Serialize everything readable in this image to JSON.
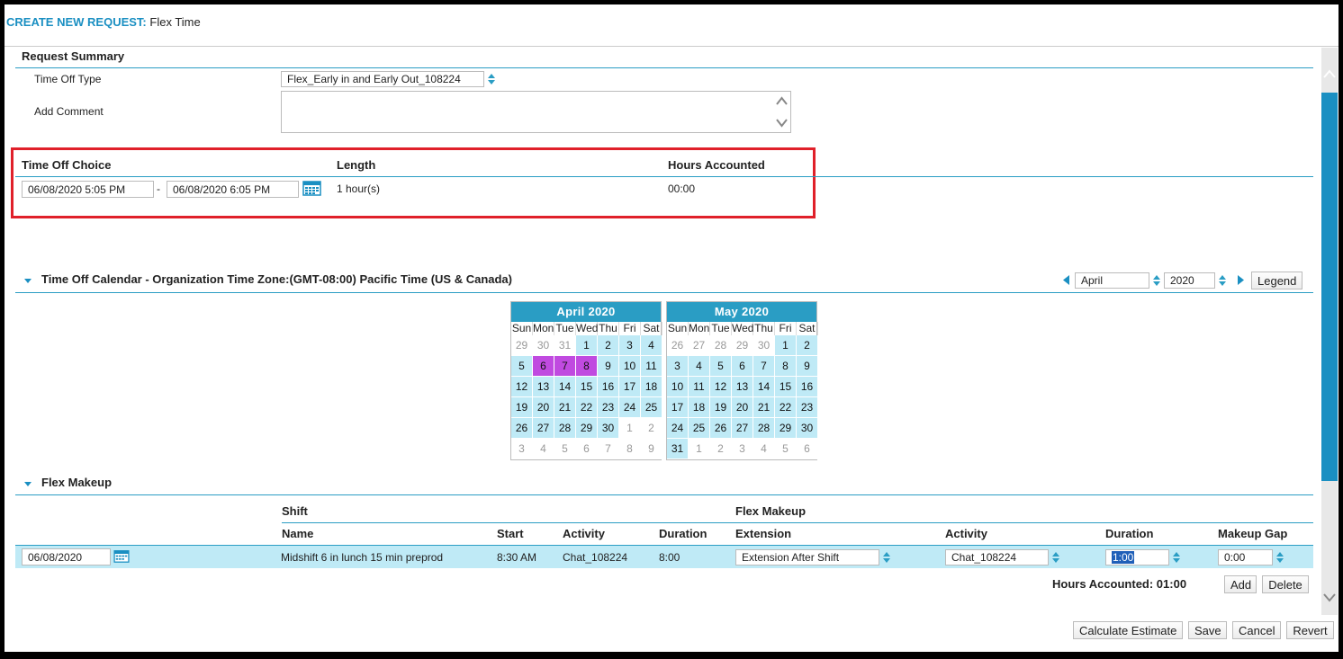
{
  "header": {
    "label": "CREATE NEW REQUEST:",
    "value": "Flex Time"
  },
  "summary": {
    "title": "Request Summary",
    "time_off_type_label": "Time Off Type",
    "time_off_type_value": "Flex_Early in and Early Out_108224",
    "add_comment_label": "Add Comment",
    "comment_value": ""
  },
  "choice": {
    "col_choice": "Time Off Choice",
    "col_length": "Length",
    "col_hours": "Hours Accounted",
    "start": "06/08/2020 5:05 PM",
    "dash": "-",
    "end": "06/08/2020 6:05 PM",
    "length": "1 hour(s)",
    "hours": "00:00"
  },
  "calendar_section": {
    "title": "Time Off Calendar - Organization Time Zone:(GMT-08:00) Pacific Time (US & Canada)",
    "month_value": "April",
    "year_value": "2020",
    "legend_label": "Legend"
  },
  "calendars": [
    {
      "title": "April 2020",
      "dow": [
        "Sun",
        "Mon",
        "Tue",
        "Wed",
        "Thu",
        "Fri",
        "Sat"
      ],
      "days": [
        {
          "d": "29",
          "s": "out"
        },
        {
          "d": "30",
          "s": "out"
        },
        {
          "d": "31",
          "s": "out"
        },
        {
          "d": "1",
          "s": "in"
        },
        {
          "d": "2",
          "s": "in"
        },
        {
          "d": "3",
          "s": "in"
        },
        {
          "d": "4",
          "s": "in"
        },
        {
          "d": "5",
          "s": "in"
        },
        {
          "d": "6",
          "s": "sel"
        },
        {
          "d": "7",
          "s": "sel"
        },
        {
          "d": "8",
          "s": "sel"
        },
        {
          "d": "9",
          "s": "in"
        },
        {
          "d": "10",
          "s": "in"
        },
        {
          "d": "11",
          "s": "in"
        },
        {
          "d": "12",
          "s": "in"
        },
        {
          "d": "13",
          "s": "in"
        },
        {
          "d": "14",
          "s": "in"
        },
        {
          "d": "15",
          "s": "in"
        },
        {
          "d": "16",
          "s": "in"
        },
        {
          "d": "17",
          "s": "in"
        },
        {
          "d": "18",
          "s": "in"
        },
        {
          "d": "19",
          "s": "in"
        },
        {
          "d": "20",
          "s": "in"
        },
        {
          "d": "21",
          "s": "in"
        },
        {
          "d": "22",
          "s": "in"
        },
        {
          "d": "23",
          "s": "in"
        },
        {
          "d": "24",
          "s": "in"
        },
        {
          "d": "25",
          "s": "in"
        },
        {
          "d": "26",
          "s": "in"
        },
        {
          "d": "27",
          "s": "in"
        },
        {
          "d": "28",
          "s": "in"
        },
        {
          "d": "29",
          "s": "in"
        },
        {
          "d": "30",
          "s": "in"
        },
        {
          "d": "1",
          "s": "out"
        },
        {
          "d": "2",
          "s": "out"
        },
        {
          "d": "3",
          "s": "out"
        },
        {
          "d": "4",
          "s": "out"
        },
        {
          "d": "5",
          "s": "out"
        },
        {
          "d": "6",
          "s": "out"
        },
        {
          "d": "7",
          "s": "out"
        },
        {
          "d": "8",
          "s": "out"
        },
        {
          "d": "9",
          "s": "out"
        }
      ]
    },
    {
      "title": "May 2020",
      "dow": [
        "Sun",
        "Mon",
        "Tue",
        "Wed",
        "Thu",
        "Fri",
        "Sat"
      ],
      "days": [
        {
          "d": "26",
          "s": "out"
        },
        {
          "d": "27",
          "s": "out"
        },
        {
          "d": "28",
          "s": "out"
        },
        {
          "d": "29",
          "s": "out"
        },
        {
          "d": "30",
          "s": "out"
        },
        {
          "d": "1",
          "s": "in"
        },
        {
          "d": "2",
          "s": "in"
        },
        {
          "d": "3",
          "s": "in"
        },
        {
          "d": "4",
          "s": "in"
        },
        {
          "d": "5",
          "s": "in"
        },
        {
          "d": "6",
          "s": "in"
        },
        {
          "d": "7",
          "s": "in"
        },
        {
          "d": "8",
          "s": "in"
        },
        {
          "d": "9",
          "s": "in"
        },
        {
          "d": "10",
          "s": "in"
        },
        {
          "d": "11",
          "s": "in"
        },
        {
          "d": "12",
          "s": "in"
        },
        {
          "d": "13",
          "s": "in"
        },
        {
          "d": "14",
          "s": "in"
        },
        {
          "d": "15",
          "s": "in"
        },
        {
          "d": "16",
          "s": "in"
        },
        {
          "d": "17",
          "s": "in"
        },
        {
          "d": "18",
          "s": "in"
        },
        {
          "d": "19",
          "s": "in"
        },
        {
          "d": "20",
          "s": "in"
        },
        {
          "d": "21",
          "s": "in"
        },
        {
          "d": "22",
          "s": "in"
        },
        {
          "d": "23",
          "s": "in"
        },
        {
          "d": "24",
          "s": "in"
        },
        {
          "d": "25",
          "s": "in"
        },
        {
          "d": "26",
          "s": "in"
        },
        {
          "d": "27",
          "s": "in"
        },
        {
          "d": "28",
          "s": "in"
        },
        {
          "d": "29",
          "s": "in"
        },
        {
          "d": "30",
          "s": "in"
        },
        {
          "d": "31",
          "s": "in"
        },
        {
          "d": "1",
          "s": "out"
        },
        {
          "d": "2",
          "s": "out"
        },
        {
          "d": "3",
          "s": "out"
        },
        {
          "d": "4",
          "s": "out"
        },
        {
          "d": "5",
          "s": "out"
        },
        {
          "d": "6",
          "s": "out"
        }
      ]
    }
  ],
  "flex": {
    "title": "Flex Makeup",
    "group_shift": "Shift",
    "group_makeup": "Flex Makeup",
    "col_name": "Name",
    "col_start": "Start",
    "col_activity": "Activity",
    "col_duration": "Duration",
    "col_extension": "Extension",
    "col_activity2": "Activity",
    "col_duration2": "Duration",
    "col_gap": "Makeup Gap",
    "row": {
      "date": "06/08/2020",
      "name": "Midshift 6 in lunch 15 min preprod",
      "start": "8:30 AM",
      "activity": "Chat_108224",
      "duration": "8:00",
      "extension": "Extension After Shift",
      "activity2": "Chat_108224",
      "duration2": "1:00",
      "gap": "0:00"
    },
    "hours_accounted": "Hours Accounted: 01:00",
    "add_label": "Add",
    "delete_label": "Delete"
  },
  "footer": {
    "calc_label": "Calculate Estimate",
    "save_label": "Save",
    "cancel_label": "Cancel",
    "revert_label": "Revert"
  },
  "colors": {
    "accent": "#2a9dc4",
    "highlight": "#e0202a",
    "selected_day": "#c04ae0",
    "day_bg": "#bfeaf6"
  }
}
